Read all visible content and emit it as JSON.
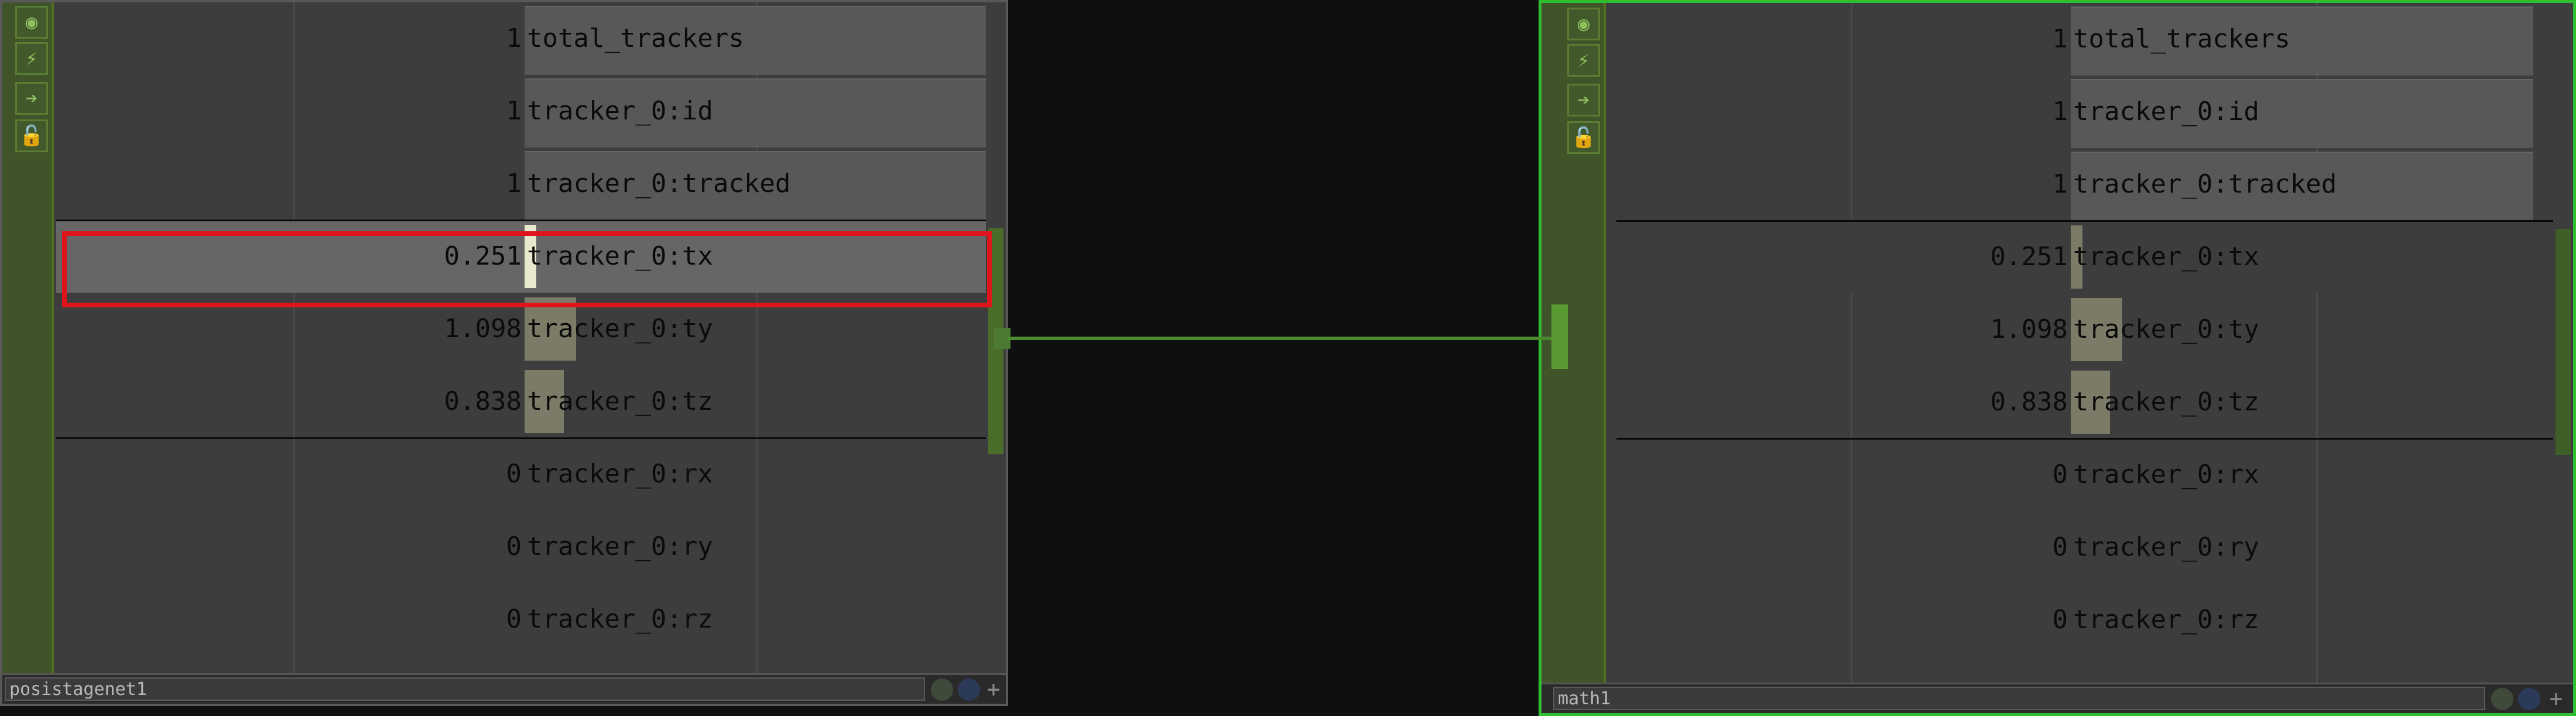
{
  "nodes": [
    {
      "name": "posistagenet1",
      "rows": [
        {
          "value": "1",
          "label": "total_trackers",
          "bar": 0
        },
        {
          "value": "1",
          "label": "tracker_0:id",
          "bar": 0
        },
        {
          "value": "1",
          "label": "tracker_0:tracked",
          "bar": 0
        },
        {
          "value": "0.251",
          "label": "tracker_0:tx",
          "bar": 0.251
        },
        {
          "value": "1.098",
          "label": "tracker_0:ty",
          "bar": 1.098
        },
        {
          "value": "0.838",
          "label": "tracker_0:tz",
          "bar": 0.838
        },
        {
          "value": "0",
          "label": "tracker_0:rx",
          "bar": 0
        },
        {
          "value": "0",
          "label": "tracker_0:ry",
          "bar": 0
        },
        {
          "value": "0",
          "label": "tracker_0:rz",
          "bar": 0
        }
      ]
    },
    {
      "name": "math1",
      "rows": [
        {
          "value": "1",
          "label": "total_trackers",
          "bar": 0
        },
        {
          "value": "1",
          "label": "tracker_0:id",
          "bar": 0
        },
        {
          "value": "1",
          "label": "tracker_0:tracked",
          "bar": 0
        },
        {
          "value": "0.251",
          "label": "tracker_0:tx",
          "bar": 0.251
        },
        {
          "value": "1.098",
          "label": "tracker_0:ty",
          "bar": 1.098
        },
        {
          "value": "0.838",
          "label": "tracker_0:tz",
          "bar": 0.838
        },
        {
          "value": "0",
          "label": "tracker_0:rx",
          "bar": 0
        },
        {
          "value": "0",
          "label": "tracker_0:ry",
          "bar": 0
        },
        {
          "value": "0",
          "label": "tracker_0:rz",
          "bar": 0
        }
      ]
    }
  ],
  "flag_icons": [
    "viewer-icon",
    "bypass-icon",
    "display-icon",
    "lock-icon"
  ],
  "colors": {
    "wire": "#4c8a2d",
    "selected_border": "#2fbe2f",
    "highlight": "#e0141c",
    "bar": "#7b7b67"
  }
}
